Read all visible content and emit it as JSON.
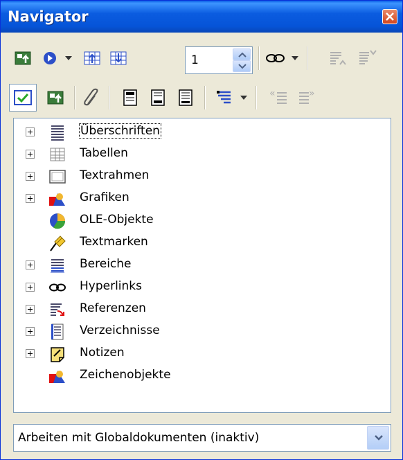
{
  "window": {
    "title": "Navigator"
  },
  "toolbar1": {
    "buttons": [
      {
        "name": "navigation-toggle-icon"
      },
      {
        "name": "navigation-icon"
      },
      {
        "name": "previous-object-icon"
      },
      {
        "name": "next-object-icon"
      },
      {
        "name": "hyperlink-drag-mode-icon"
      },
      {
        "name": "promote-chapter-icon"
      },
      {
        "name": "demote-chapter-icon"
      }
    ],
    "page_number": "1"
  },
  "toolbar2": {
    "buttons": [
      {
        "name": "content-view-icon"
      },
      {
        "name": "toggle-content-icon"
      },
      {
        "name": "edit-attach-icon"
      },
      {
        "name": "header-icon"
      },
      {
        "name": "footer-icon"
      },
      {
        "name": "anchor-endnote-icon"
      },
      {
        "name": "heading-levels-icon"
      },
      {
        "name": "promote-level-icon"
      },
      {
        "name": "demote-level-icon"
      }
    ]
  },
  "tree": {
    "items": [
      {
        "label": "Überschriften",
        "icon": "headings-icon",
        "expandable": true,
        "selected": true
      },
      {
        "label": "Tabellen",
        "icon": "table-icon",
        "expandable": true
      },
      {
        "label": "Textrahmen",
        "icon": "text-frame-icon",
        "expandable": true
      },
      {
        "label": "Grafiken",
        "icon": "graphics-icon",
        "expandable": true
      },
      {
        "label": "OLE-Objekte",
        "icon": "ole-object-icon",
        "expandable": false
      },
      {
        "label": "Textmarken",
        "icon": "bookmark-icon",
        "expandable": false
      },
      {
        "label": "Bereiche",
        "icon": "sections-icon",
        "expandable": true
      },
      {
        "label": "Hyperlinks",
        "icon": "hyperlink-icon",
        "expandable": true
      },
      {
        "label": "Referenzen",
        "icon": "references-icon",
        "expandable": true
      },
      {
        "label": "Verzeichnisse",
        "icon": "indexes-icon",
        "expandable": true
      },
      {
        "label": "Notizen",
        "icon": "comments-icon",
        "expandable": true
      },
      {
        "label": "Zeichenobjekte",
        "icon": "drawing-objects-icon",
        "expandable": false
      }
    ]
  },
  "document_select": {
    "value": "Arbeiten mit Globaldokumenten (inaktiv)"
  },
  "colors": {
    "titlebar": "#0654d8",
    "face": "#ece9d8",
    "border": "#7f9db9"
  }
}
